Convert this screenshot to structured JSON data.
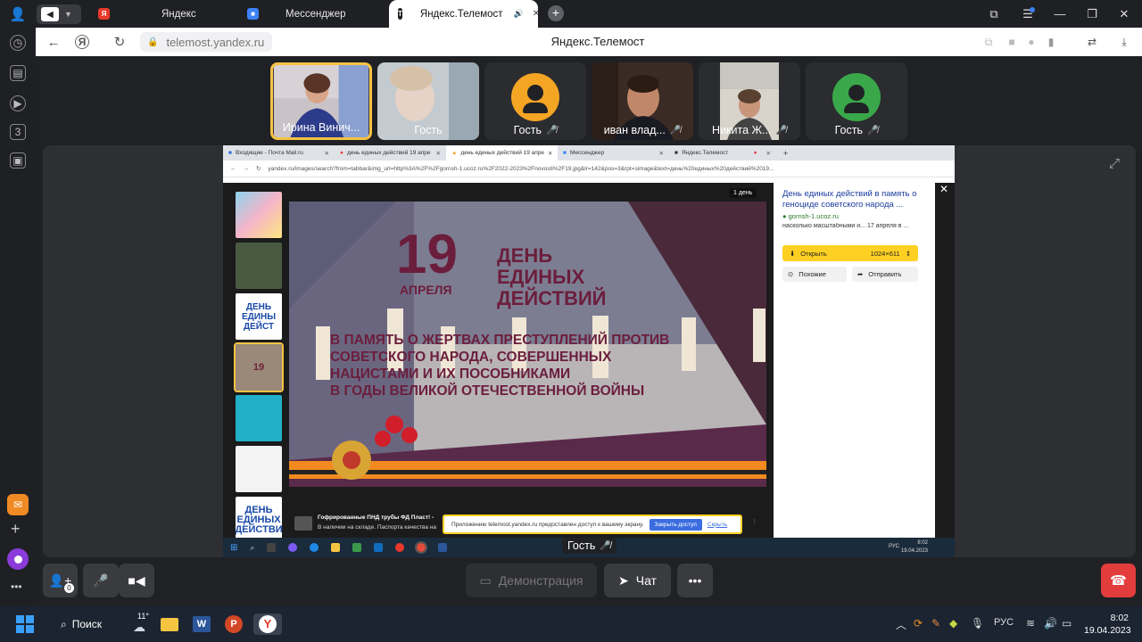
{
  "browser": {
    "tabs": [
      {
        "label": "Яндекс",
        "icon": "yandex-icon",
        "color": "#e8382a"
      },
      {
        "label": "Мессенджер",
        "icon": "messenger-icon",
        "color": "#3b82f6"
      },
      {
        "label": "Яндекс.Телемост",
        "icon": "telemost-icon",
        "color": "#222222",
        "sound": "🔊",
        "close": "✕"
      }
    ],
    "new_tab": "+",
    "url": "telemost.yandex.ru",
    "page_title": "Яндекс.Телемост"
  },
  "participants": [
    {
      "name": "Ирина Винич...",
      "muted": false,
      "active": true
    },
    {
      "name": "Гость",
      "muted": false,
      "active": false
    },
    {
      "name": "Гость",
      "muted": true,
      "active": false,
      "avatar_color": "#f5a524"
    },
    {
      "name": "иван влад...",
      "muted": true,
      "active": false
    },
    {
      "name": "Никита Ж...",
      "muted": true,
      "active": false
    },
    {
      "name": "Гость",
      "muted": true,
      "active": false,
      "avatar_color": "#3aa84a"
    }
  ],
  "mute_glyph": "🎤̸",
  "shared": {
    "tabs": [
      "Входящие - Почта Mail.ru",
      "день единых действий 19 апре",
      "день единых действий 19 апре",
      "Мессенджер",
      "Яндекс.Телемост"
    ],
    "url": "yandex.ru/images/search?from=tabbar&img_url=http%3A%2F%2Fgornsh-1.ucoz.ru%2F2022-2023%2Fnovosti%2F19.jpg&lr=142&pos=3&rpt=simage&text=день%20единых%20действий%2019...",
    "day_badge": "1 день",
    "poster": {
      "num": "19",
      "month": "АПРЕЛЯ",
      "title": [
        "ДЕНЬ",
        "ЕДИНЫХ",
        "ДЕЙСТВИЙ"
      ],
      "body": [
        "В ПАМЯТЬ О ЖЕРТВАХ ПРЕСТУПЛЕНИЙ ПРОТИВ",
        "СОВЕТСКОГО НАРОДА, СОВЕРШЕННЫХ",
        "НАЦИСТАМИ И ИХ ПОСОБНИКАМИ",
        "В ГОДЫ ВЕЛИКОЙ ОТЕЧЕСТВЕННОЙ ВОЙНЫ"
      ]
    },
    "thumb_texts": [
      "",
      "",
      "ДЕНЬ ЕДИНЫ ДЕЙСТ",
      "19",
      "",
      "",
      "ДЕНЬ ЕДИНЫХ ДЕЙСТВИ"
    ],
    "result": {
      "title": "День единых действий в память о геноциде советского народа ...",
      "domain": "gornsh-1.ucoz.ru",
      "snippet": "насколько масштабными и... 17 апреля в ...",
      "open_label": "Открыть",
      "size": "1024×611",
      "similar_label": "Похожие",
      "send_label": "Отправить"
    },
    "ad": {
      "title": "Гофрированные ПНД трубы ФД Пласт! -",
      "text": "В наличии на складе. Паспорта качества на"
    },
    "banner": {
      "text": "Приложению telemost.yandex.ru предоставлен доступ к вашему экрану.",
      "stop": "Закрыть доступ",
      "hide": "Скрыть"
    },
    "taskbar_lang": "РУС",
    "taskbar_time": "8:02",
    "taskbar_date": "19.04.2023"
  },
  "guest_label": "Гость",
  "controls": {
    "participants_count": "0",
    "demo": "Демонстрация",
    "chat": "Чат",
    "more": "•••"
  },
  "taskbar": {
    "search": "Поиск",
    "weather": "11°",
    "lang": "РУС",
    "time": "8:02",
    "date": "19.04.2023"
  }
}
